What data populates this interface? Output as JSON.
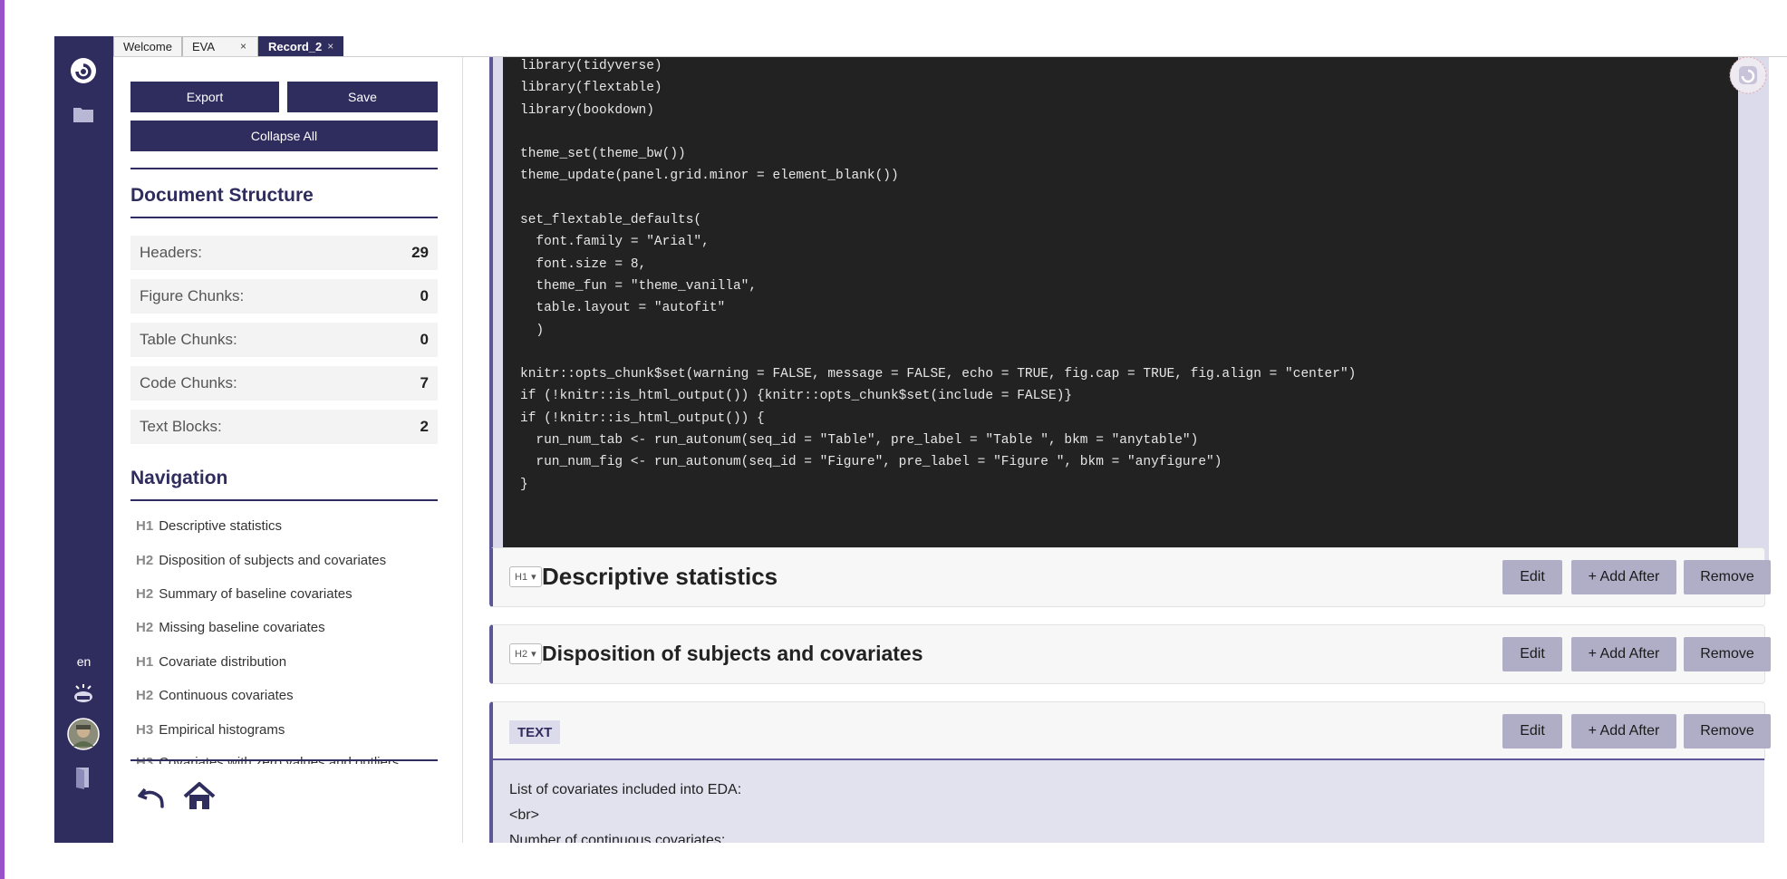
{
  "tabs": [
    {
      "label": "Welcome",
      "close": ""
    },
    {
      "label": "EVA",
      "close": "×"
    },
    {
      "label": "Record_2",
      "close": "×"
    }
  ],
  "rail": {
    "lang": "en"
  },
  "sidebar": {
    "export_label": "Export",
    "save_label": "Save",
    "collapse_label": "Collapse All",
    "structure_title": "Document Structure",
    "stats": [
      {
        "label": "Headers:",
        "value": "29"
      },
      {
        "label": "Figure Chunks:",
        "value": "0"
      },
      {
        "label": "Table Chunks:",
        "value": "0"
      },
      {
        "label": "Code Chunks:",
        "value": "7"
      },
      {
        "label": "Text Blocks:",
        "value": "2"
      }
    ],
    "navigation_title": "Navigation",
    "nav": [
      {
        "level": "H1",
        "label": "Descriptive statistics"
      },
      {
        "level": "H2",
        "label": "Disposition of subjects and covariates"
      },
      {
        "level": "H2",
        "label": "Summary of baseline covariates"
      },
      {
        "level": "H2",
        "label": "Missing baseline covariates"
      },
      {
        "level": "H1",
        "label": "Covariate distribution"
      },
      {
        "level": "H2",
        "label": "Continuous covariates"
      },
      {
        "level": "H3",
        "label": "Empirical histograms"
      },
      {
        "level": "H3",
        "label": "Covariates with zero values and outliers"
      }
    ]
  },
  "code": [
    "library(tidyverse)",
    "library(flextable)",
    "library(bookdown)",
    "",
    "theme_set(theme_bw())",
    "theme_update(panel.grid.minor = element_blank())",
    "",
    "set_flextable_defaults(",
    "  font.family = \"Arial\",",
    "  font.size = 8,",
    "  theme_fun = \"theme_vanilla\",",
    "  table.layout = \"autofit\"",
    "  )",
    "",
    "knitr::opts_chunk$set(warning = FALSE, message = FALSE, echo = TRUE, fig.cap = TRUE, fig.align = \"center\")",
    "if (!knitr::is_html_output()) {knitr::opts_chunk$set(include = FALSE)}",
    "if (!knitr::is_html_output()) {",
    "  run_num_tab <- run_autonum(seq_id = \"Table\", pre_label = \"Table \", bkm = \"anytable\")",
    "  run_num_fig <- run_autonum(seq_id = \"Figure\", pre_label = \"Figure \", bkm = \"anyfigure\")",
    "}"
  ],
  "blocks": [
    {
      "level": "H1",
      "title": "Descriptive statistics"
    },
    {
      "level": "H2",
      "title": "Disposition of subjects and covariates"
    }
  ],
  "text_block": {
    "label": "TEXT",
    "lines": [
      "List of covariates included into EDA:",
      "<br>",
      "Number of continuous covariates:"
    ]
  },
  "actions": {
    "edit": "Edit",
    "add_after": "+ Add After",
    "remove": "Remove"
  },
  "dropdown_caret": "▾"
}
